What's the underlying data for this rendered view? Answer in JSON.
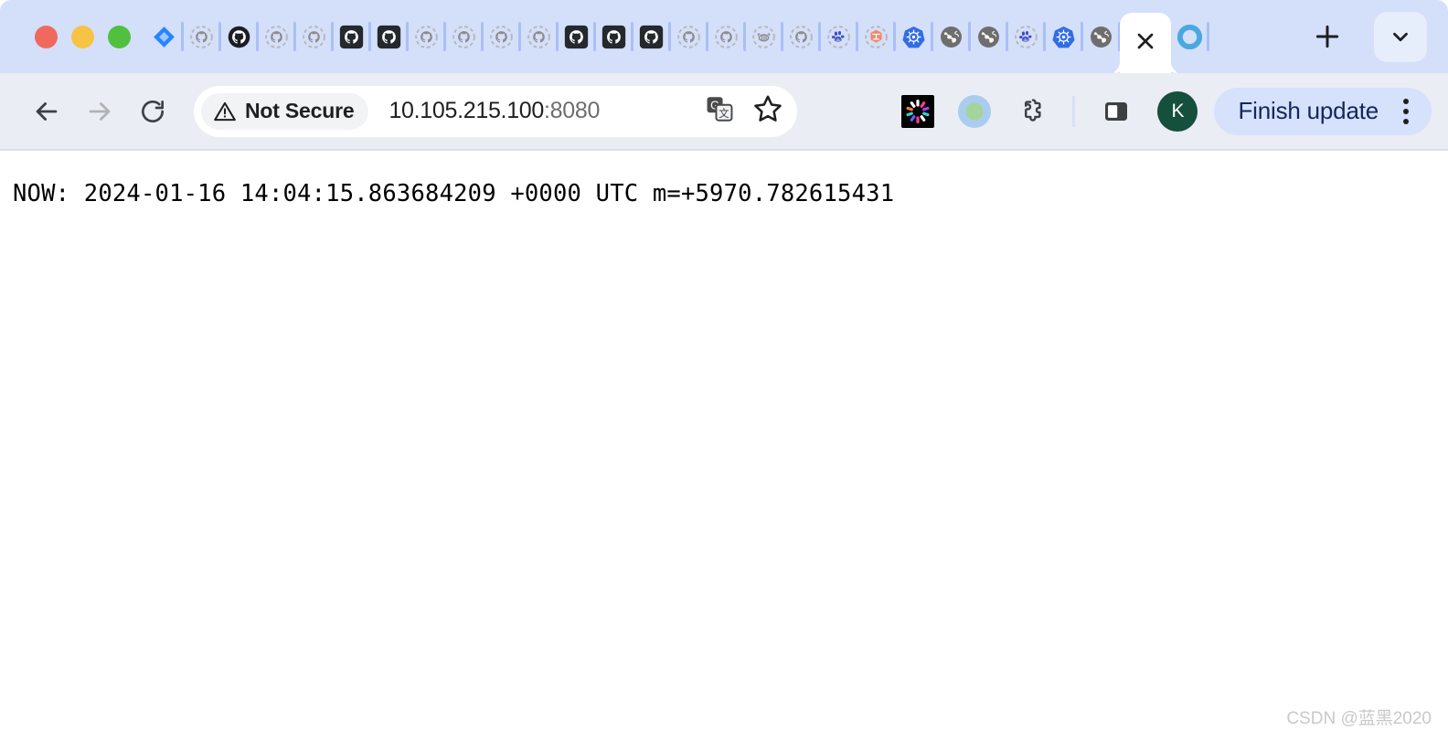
{
  "window": {
    "traffic_lights": [
      {
        "name": "close",
        "color": "#ef6a5d"
      },
      {
        "name": "minimize",
        "color": "#f6c344"
      },
      {
        "name": "zoom",
        "color": "#52c03f"
      }
    ],
    "tabstrip_color": "#d4dffa",
    "toolbar_color": "#eaedf4"
  },
  "tabs": {
    "items": [
      {
        "icon": "jira-diamond-icon",
        "title": "",
        "state": "loaded"
      },
      {
        "icon": "github-loading-icon",
        "title": "",
        "state": "loading"
      },
      {
        "icon": "github-icon",
        "title": "",
        "state": "loaded"
      },
      {
        "icon": "github-loading-icon",
        "title": "",
        "state": "loading"
      },
      {
        "icon": "github-loading-icon",
        "title": "",
        "state": "loading"
      },
      {
        "icon": "github-dark-icon",
        "title": "",
        "state": "loaded"
      },
      {
        "icon": "github-dark-icon",
        "title": "",
        "state": "loaded"
      },
      {
        "icon": "github-loading-icon",
        "title": "",
        "state": "loading"
      },
      {
        "icon": "github-loading-icon",
        "title": "",
        "state": "loading"
      },
      {
        "icon": "github-loading-icon",
        "title": "",
        "state": "loading"
      },
      {
        "icon": "github-loading-icon",
        "title": "",
        "state": "loading"
      },
      {
        "icon": "github-dark-icon",
        "title": "",
        "state": "loaded"
      },
      {
        "icon": "github-dark-icon",
        "title": "",
        "state": "loaded"
      },
      {
        "icon": "github-dark-icon",
        "title": "",
        "state": "loaded"
      },
      {
        "icon": "github-loading-icon",
        "title": "",
        "state": "loading"
      },
      {
        "icon": "github-loading-icon",
        "title": "",
        "state": "loading"
      },
      {
        "icon": "bee-loading-icon",
        "title": "",
        "state": "loading"
      },
      {
        "icon": "github-loading-icon",
        "title": "",
        "state": "loading"
      },
      {
        "icon": "baidu-paw-icon",
        "title": "",
        "state": "loading"
      },
      {
        "icon": "orange-hexagon-icon",
        "title": "",
        "state": "loading"
      },
      {
        "icon": "kubernetes-icon",
        "title": "",
        "state": "loaded"
      },
      {
        "icon": "globe-icon",
        "title": "",
        "state": "loaded"
      },
      {
        "icon": "globe-icon",
        "title": "",
        "state": "loaded"
      },
      {
        "icon": "baidu-paw-icon",
        "title": "",
        "state": "loading"
      },
      {
        "icon": "kubernetes-icon",
        "title": "",
        "state": "loaded"
      },
      {
        "icon": "globe-icon",
        "title": "",
        "state": "loaded"
      }
    ],
    "active_tab": {
      "icon": "close-icon",
      "title": "",
      "close_label": "×"
    },
    "trailing_tab": {
      "icon": "blue-ring-icon",
      "title": ""
    },
    "new_tab_label": "+",
    "tab_search_icon": "chevron-down-icon"
  },
  "toolbar": {
    "back_icon": "back-arrow-icon",
    "forward_icon": "forward-arrow-icon",
    "reload_icon": "reload-icon",
    "security": {
      "icon": "warning-triangle-icon",
      "label": "Not Secure"
    },
    "url": "10.105.215.100:8080",
    "url_host": "10.105.215.100",
    "url_port": ":8080",
    "translate_icon": "translate-icon",
    "bookmark_icon": "star-icon",
    "extensions": [
      {
        "name": "pinwheel-extension-icon"
      },
      {
        "name": "circle-extension-icon"
      },
      {
        "name": "puzzle-extensions-icon"
      }
    ],
    "side_panel_icon": "side-panel-icon",
    "avatar_letter": "K",
    "update_button_label": "Finish update",
    "menu_icon": "kebab-menu-icon"
  },
  "page": {
    "content_text": "NOW: 2024-01-16 14:04:15.863684209 +0000 UTC m=+5970.782615431",
    "watermark": "CSDN @蓝黑2020"
  }
}
